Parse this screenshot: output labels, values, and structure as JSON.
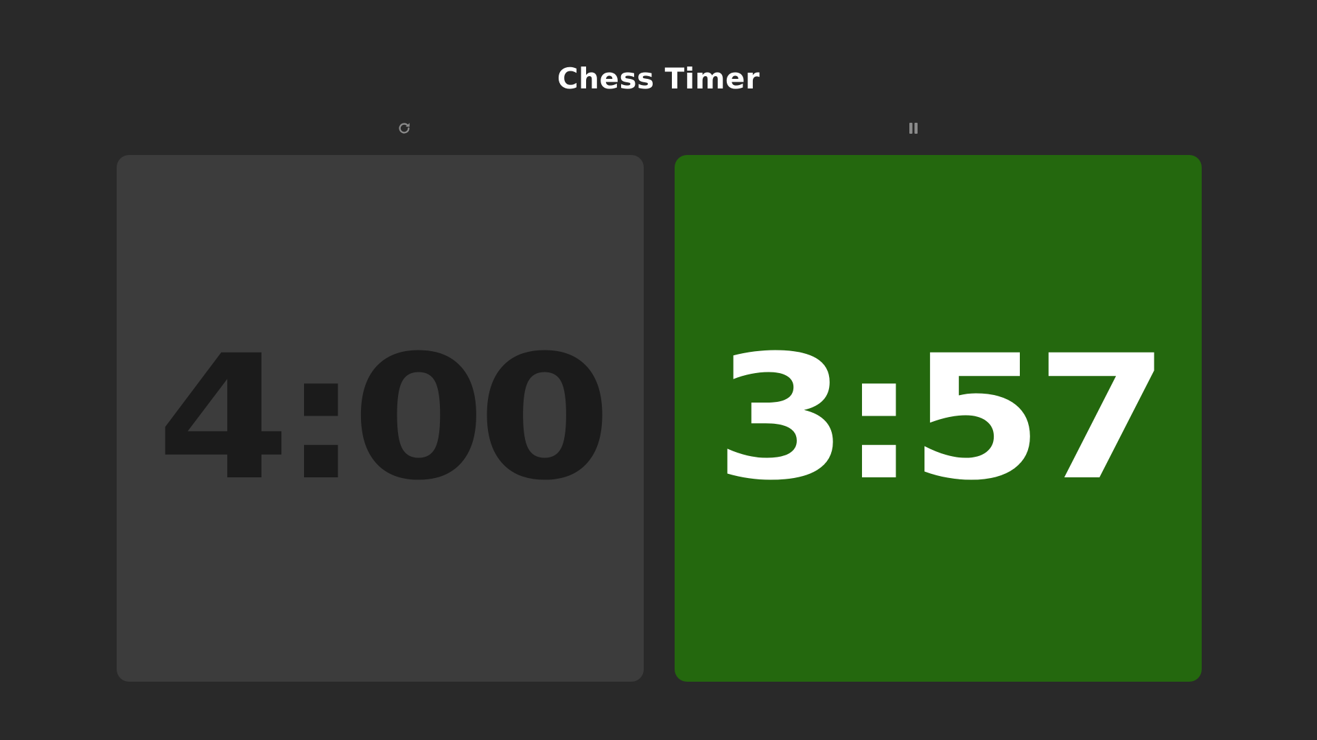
{
  "app": {
    "title": "Chess Timer"
  },
  "controls": {
    "reset_icon": "refresh-icon",
    "pause_icon": "pause-icon",
    "icon_color": "#8a8a8a"
  },
  "players": [
    {
      "time": "4:00",
      "active": false,
      "bg_color": "#3c3c3c",
      "text_color": "#1b1b1b"
    },
    {
      "time": "3:57",
      "active": true,
      "bg_color": "#24680e",
      "text_color": "#ffffff"
    }
  ]
}
